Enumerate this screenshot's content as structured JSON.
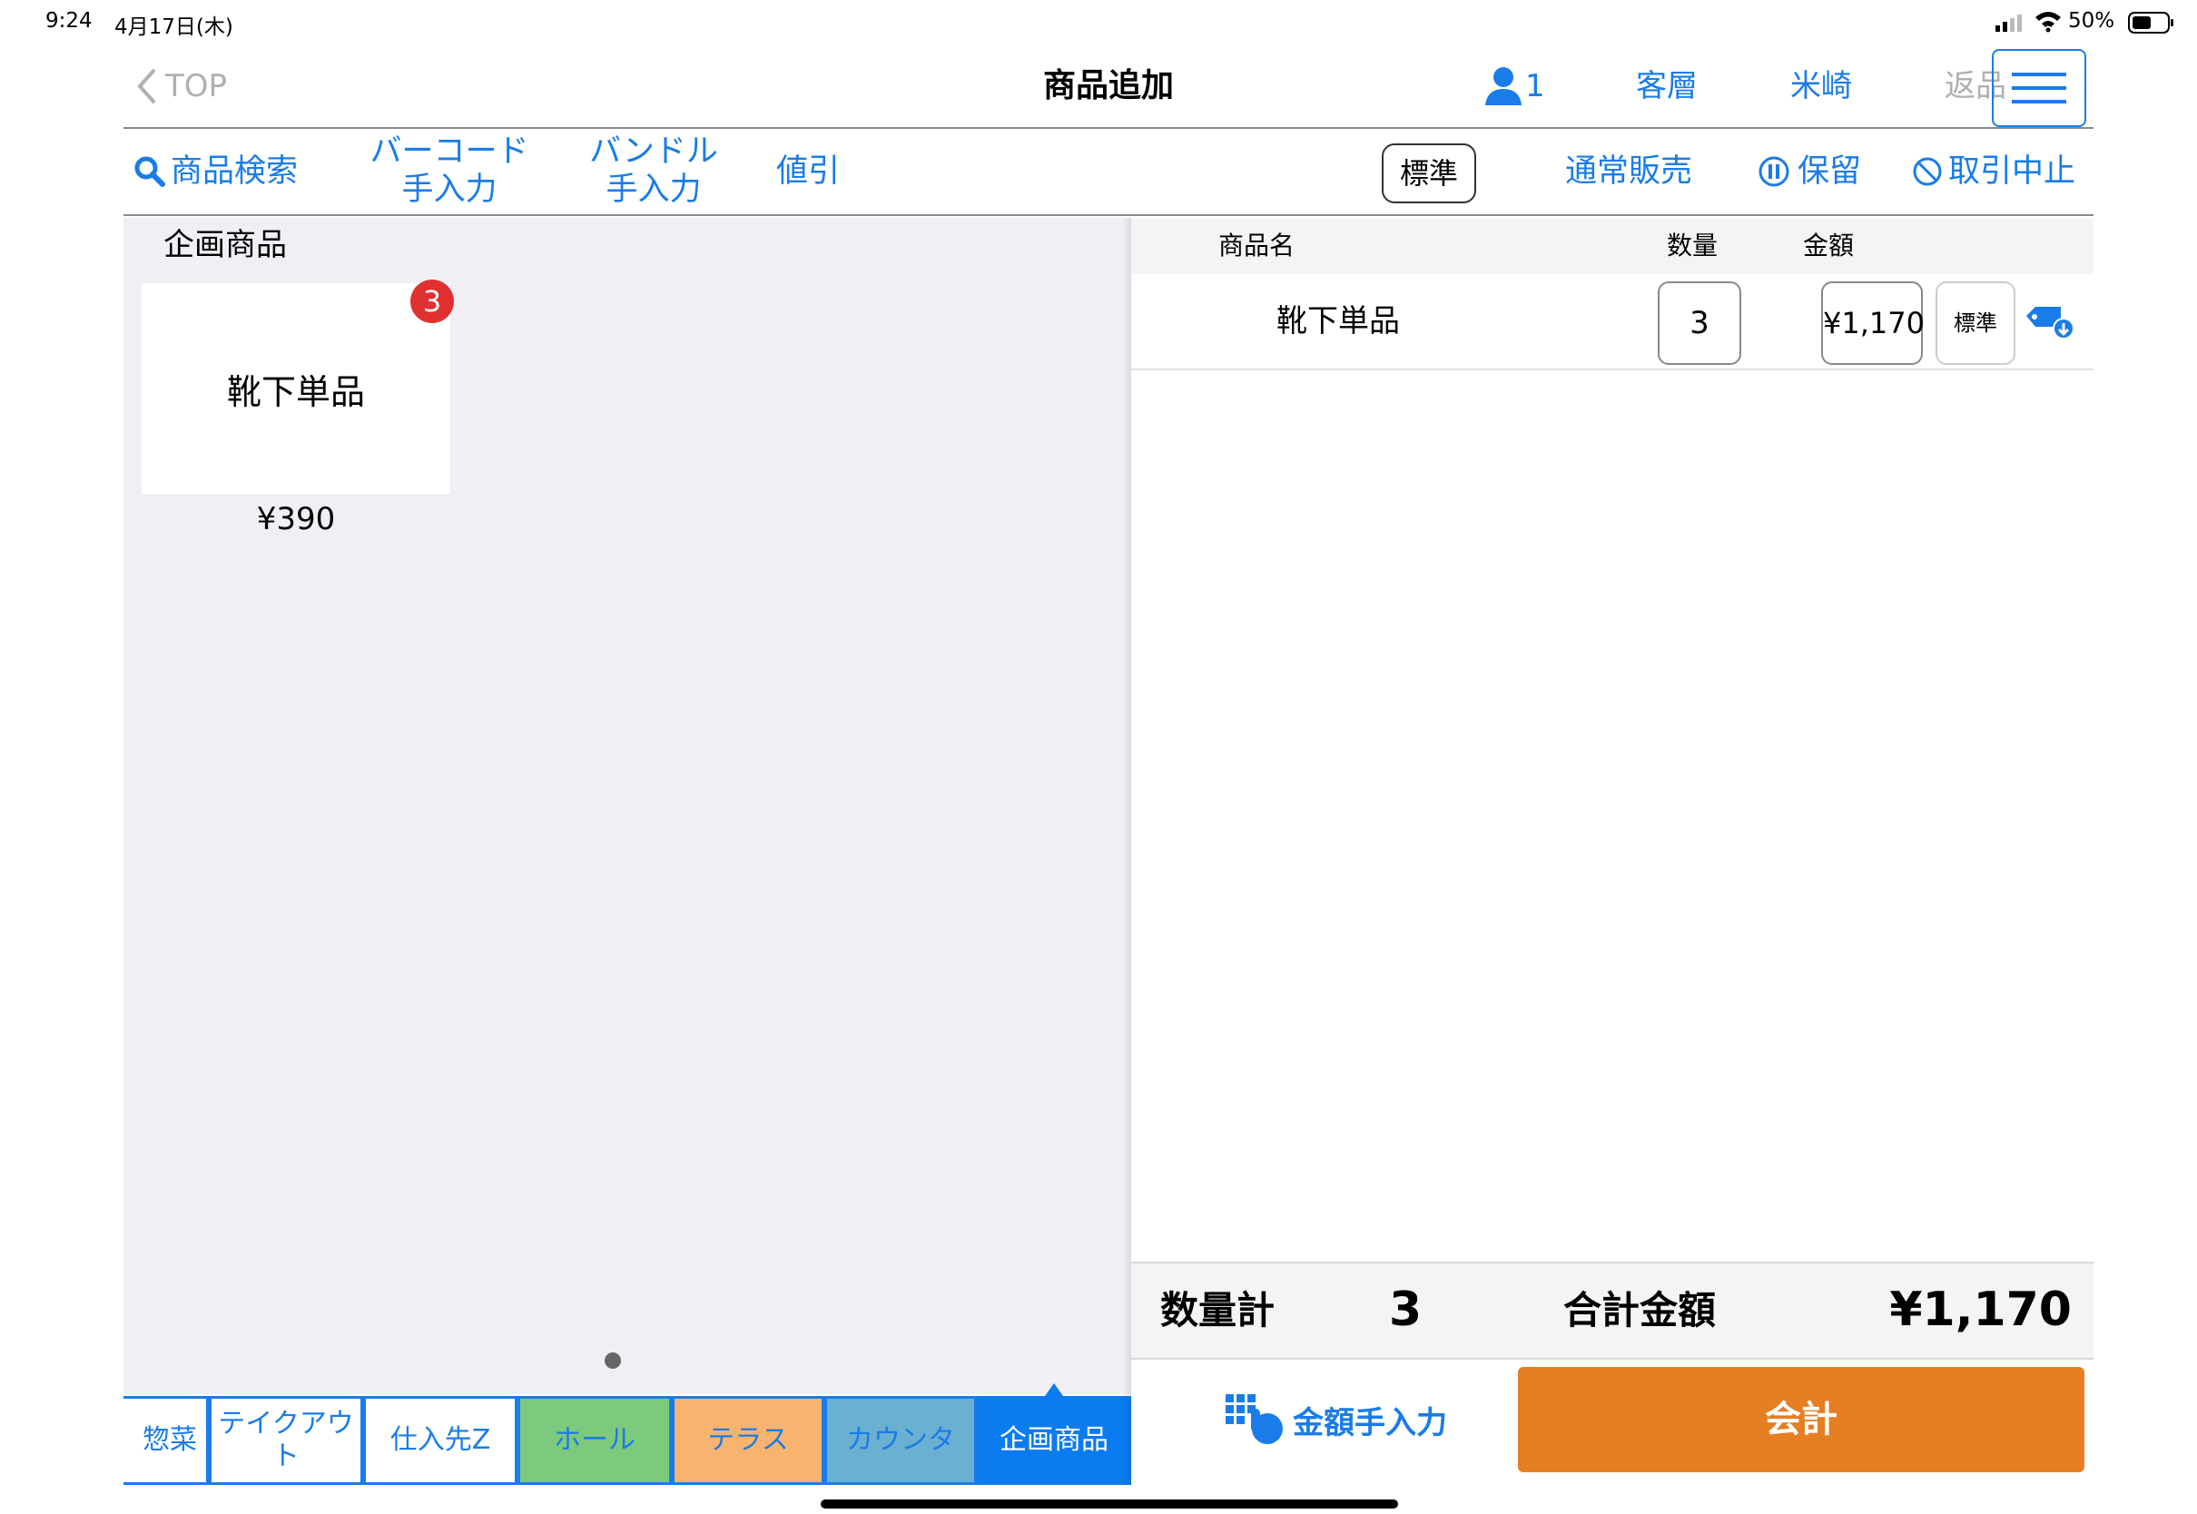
{
  "status_bar": {
    "time": "9:24",
    "date": "4月17日(木)",
    "battery": "50%"
  },
  "nav": {
    "back_label": "TOP",
    "title": "商品追加",
    "customer_count": "1",
    "customer_type": "客層",
    "staff": "米崎",
    "return_label": "返品"
  },
  "toolbar": {
    "product_search": "商品検索",
    "barcode_line1": "バーコード",
    "barcode_line2": "手入力",
    "bundle_line1": "バンドル",
    "bundle_line2": "手入力",
    "discount": "値引",
    "price_mode": "標準",
    "sale_type": "通常販売",
    "hold": "保留",
    "cancel": "取引中止"
  },
  "left": {
    "section_title": "企画商品",
    "products": [
      {
        "name": "靴下単品",
        "price": "¥390",
        "badge": "3"
      }
    ]
  },
  "categories": [
    {
      "label": "惣菜",
      "bg": "#ffffff",
      "color": "#1a7ce8"
    },
    {
      "label": "テイクアウト",
      "bg": "#ffffff",
      "color": "#1a7ce8"
    },
    {
      "label": "仕入先Z",
      "bg": "#ffffff",
      "color": "#1a7ce8"
    },
    {
      "label": "ホール",
      "bg": "#7dc97d",
      "color": "#1a7ce8"
    },
    {
      "label": "テラス",
      "bg": "#f8b46e",
      "color": "#1a7ce8"
    },
    {
      "label": "カウンタ",
      "bg": "#6ab0d0",
      "color": "#1a7ce8"
    },
    {
      "label": "企画商品",
      "bg": "#0a7cf0",
      "color": "#ffffff"
    }
  ],
  "cart": {
    "header_name": "商品名",
    "header_qty": "数量",
    "header_amount": "金額",
    "rows": [
      {
        "name": "靴下単品",
        "qty": "3",
        "amount": "¥1,170",
        "mode": "標準"
      }
    ]
  },
  "summary": {
    "qty_label": "数量計",
    "qty_value": "3",
    "total_label": "合計金額",
    "total_value": "¥1,170"
  },
  "actions": {
    "manual_amount": "金額手入力",
    "checkout": "会計"
  },
  "colors": {
    "accent": "#1a7ce8",
    "checkout": "#e67e22",
    "badge": "#e03030"
  }
}
